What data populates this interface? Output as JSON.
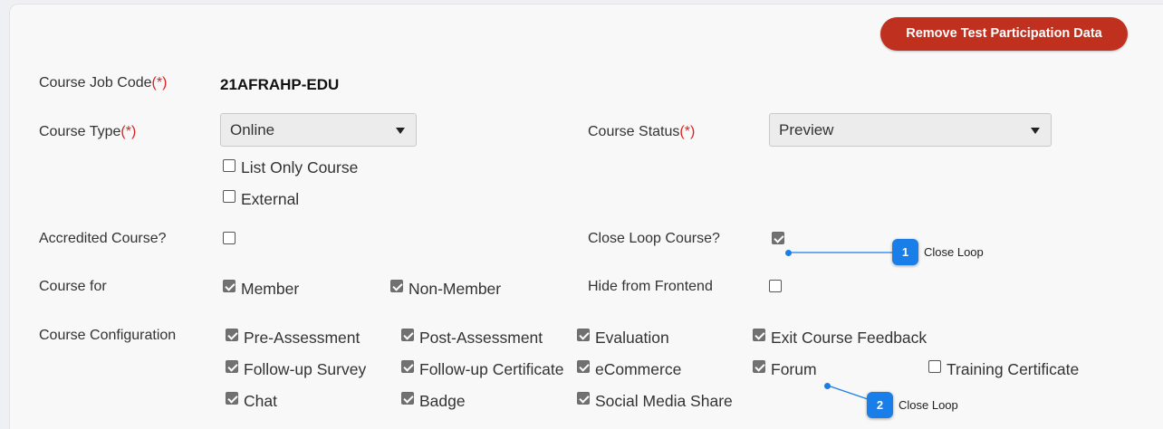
{
  "header": {
    "remove_button": "Remove Test Participation Data"
  },
  "fields": {
    "job_code": {
      "label": "Course Job Code",
      "req": "(*)",
      "value": "21AFRAHP-EDU"
    },
    "course_type": {
      "label": "Course Type",
      "req": "(*)",
      "value": "Online"
    },
    "course_status": {
      "label": "Course Status",
      "req": "(*)",
      "value": "Preview"
    },
    "list_only": {
      "label": "List Only Course",
      "checked": false
    },
    "external": {
      "label": "External",
      "checked": false
    },
    "accredited": {
      "label": "Accredited Course?",
      "checked": false
    },
    "close_loop": {
      "label": "Close Loop Course?",
      "checked": true
    },
    "course_for": {
      "label": "Course for"
    },
    "member": {
      "label": "Member",
      "checked": true
    },
    "non_member": {
      "label": "Non-Member",
      "checked": true
    },
    "hide_frontend": {
      "label": "Hide from Frontend",
      "checked": false
    },
    "config": {
      "label": "Course Configuration",
      "items": [
        {
          "label": "Pre-Assessment",
          "checked": true
        },
        {
          "label": "Post-Assessment",
          "checked": true
        },
        {
          "label": "Evaluation",
          "checked": true
        },
        {
          "label": "Exit Course Feedback",
          "checked": true
        },
        {
          "label": "Follow-up Survey",
          "checked": true
        },
        {
          "label": "Follow-up Certificate",
          "checked": true
        },
        {
          "label": "eCommerce",
          "checked": true
        },
        {
          "label": "Forum",
          "checked": true
        },
        {
          "label": "Training Certificate",
          "checked": false
        },
        {
          "label": "Chat",
          "checked": true
        },
        {
          "label": "Badge",
          "checked": true
        },
        {
          "label": "Social Media Share",
          "checked": true
        }
      ]
    }
  },
  "annotations": [
    {
      "number": "1",
      "text": "Close Loop"
    },
    {
      "number": "2",
      "text": "Close Loop"
    }
  ],
  "colors": {
    "button_bg": "#c0301f",
    "badge_bg": "#1a7ee8",
    "required": "#e02020"
  }
}
